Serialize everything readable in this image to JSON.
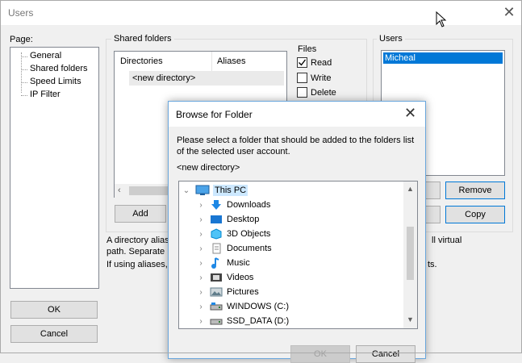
{
  "window": {
    "title": "Users"
  },
  "page_label": "Page:",
  "pages": [
    "General",
    "Shared folders",
    "Speed Limits",
    "IP Filter"
  ],
  "shared_folders": {
    "title": "Shared folders",
    "columns": [
      "Directories",
      "Aliases"
    ],
    "rows": [
      "<new directory>"
    ],
    "add_label": "Add"
  },
  "files": {
    "title": "Files",
    "options": [
      {
        "label": "Read",
        "checked": true
      },
      {
        "label": "Write",
        "checked": false
      },
      {
        "label": "Delete",
        "checked": false
      }
    ]
  },
  "users": {
    "title": "Users",
    "items": [
      "Micheal"
    ],
    "remove_label": "Remove",
    "copy_label": "Copy"
  },
  "notes": {
    "line1a": "A directory alias",
    "line1b": "ll virtual",
    "line2": "path. Separate m",
    "line3a": "If using aliases, p",
    "line3b": "ts."
  },
  "ok_label": "OK",
  "cancel_label": "Cancel",
  "dialog": {
    "title": "Browse for Folder",
    "message": "Please select a folder that should be added to the folders list of the selected user account.",
    "current": "<new directory>",
    "root": "This PC",
    "folders": [
      {
        "name": "Downloads",
        "icon": "downloads-icon",
        "color": "#1e88e5"
      },
      {
        "name": "Desktop",
        "icon": "desktop-icon",
        "color": "#1976d2"
      },
      {
        "name": "3D Objects",
        "icon": "3d-objects-icon",
        "color": "#4fc3f7"
      },
      {
        "name": "Documents",
        "icon": "documents-icon",
        "color": "#9e9e9e"
      },
      {
        "name": "Music",
        "icon": "music-icon",
        "color": "#1e88e5"
      },
      {
        "name": "Videos",
        "icon": "videos-icon",
        "color": "#555555"
      },
      {
        "name": "Pictures",
        "icon": "pictures-icon",
        "color": "#607d8b"
      },
      {
        "name": "WINDOWS (C:)",
        "icon": "drive-c-icon",
        "color": "#555555"
      },
      {
        "name": "SSD_DATA (D:)",
        "icon": "drive-d-icon",
        "color": "#555555"
      }
    ],
    "ok_label": "OK",
    "cancel_label": "Cancel"
  },
  "colors": {
    "accent": "#0078d7",
    "selection": "#0078d7",
    "background": "#f0f0f0"
  }
}
